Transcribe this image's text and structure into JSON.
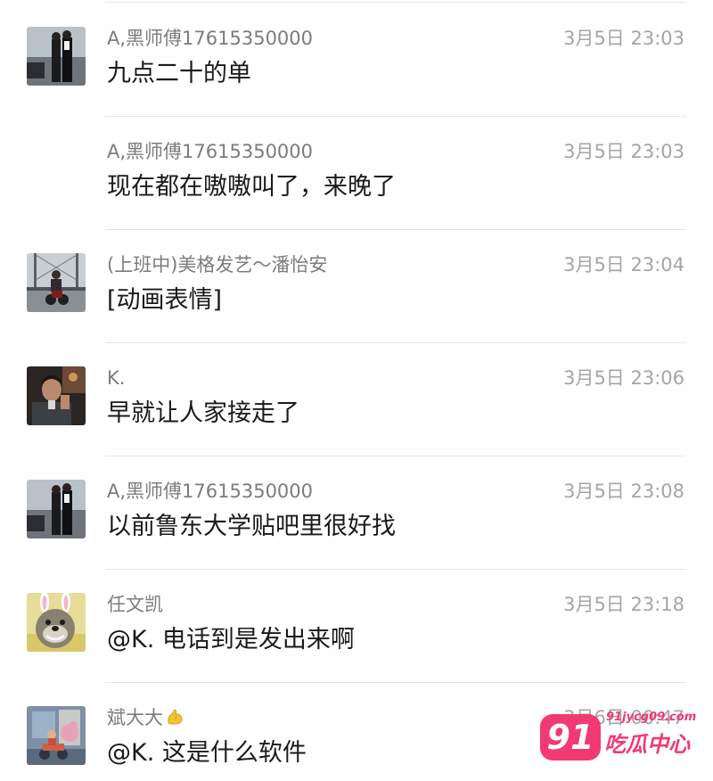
{
  "comments": [
    {
      "name": "A,黑师傅17615350000",
      "time": "3月5日 23:03",
      "text": "九点二十的单",
      "avatar": "couple-photo-avatar"
    },
    {
      "name": "A,黑师傅17615350000",
      "time": "3月5日 23:03",
      "text": "现在都在嗷嗷叫了，来晚了",
      "avatar": "none"
    },
    {
      "name": "(上班中)美格发艺～潘怡安",
      "time": "3月5日 23:04",
      "text": "[动画表情]",
      "avatar": "motorbike-bridge-avatar"
    },
    {
      "name": "K.",
      "time": "3月5日 23:06",
      "text": "早就让人家接走了",
      "avatar": "man-portrait-avatar"
    },
    {
      "name": "A,黑师傅17615350000",
      "time": "3月5日 23:08",
      "text": "以前鲁东大学贴吧里很好找",
      "avatar": "couple-photo-avatar"
    },
    {
      "name": "任文凯",
      "time": "3月5日 23:18",
      "text": "@K. 电话到是发出来啊",
      "avatar": "dog-bunny-ears-avatar"
    },
    {
      "name": "斌大大",
      "time": "3月6日 00:47",
      "text": "@K. 这是什么软件",
      "avatar": "scooter-illustration-avatar",
      "name_emoji": "flexed-biceps-icon"
    }
  ],
  "watermark": {
    "badge": "91",
    "url": "91jycg09.com",
    "text": "吃瓜中心"
  }
}
